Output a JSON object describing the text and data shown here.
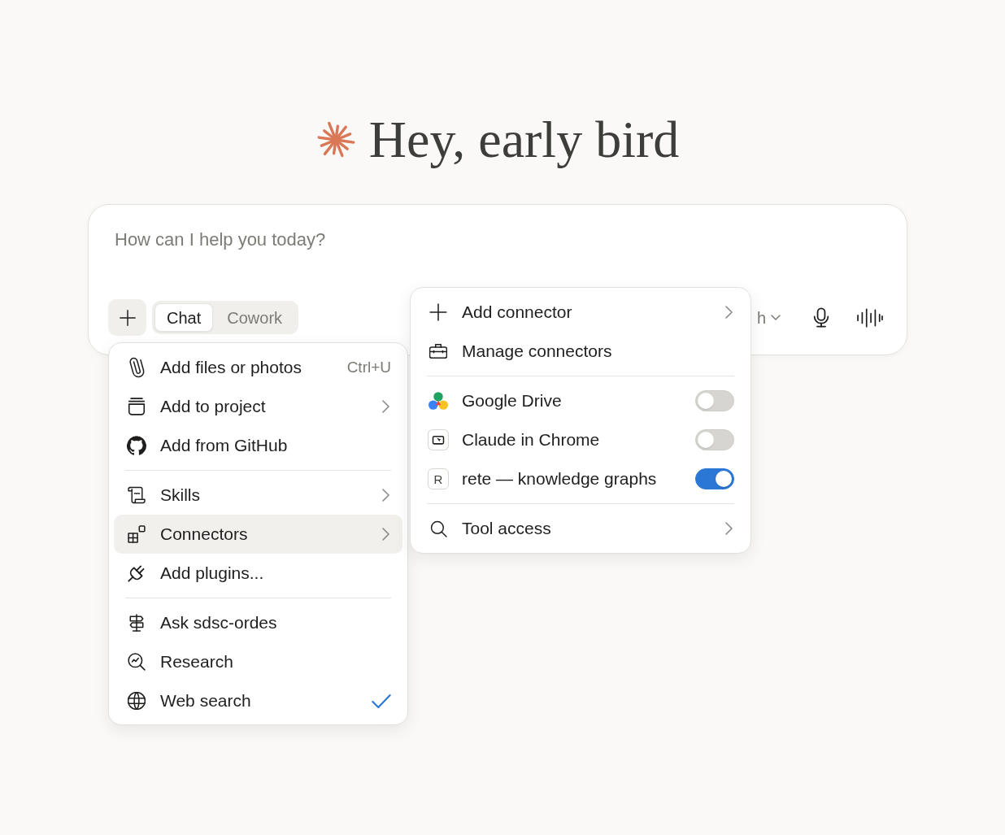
{
  "greeting": {
    "title": "Hey, early bird"
  },
  "composer": {
    "placeholder": "How can I help you today?",
    "mode_tabs": [
      {
        "label": "Chat",
        "selected": true
      },
      {
        "label": "Cowork",
        "selected": false
      }
    ],
    "model_selector": {
      "label": "h"
    }
  },
  "attach_menu": {
    "sections": [
      {
        "items": [
          {
            "label": "Add files or photos",
            "shortcut": "Ctrl+U",
            "submenu": false,
            "selected": false
          },
          {
            "label": "Add to project",
            "submenu": true,
            "selected": false
          },
          {
            "label": "Add from GitHub",
            "submenu": false,
            "selected": false
          }
        ]
      },
      {
        "items": [
          {
            "label": "Skills",
            "submenu": true,
            "selected": false
          },
          {
            "label": "Connectors",
            "submenu": true,
            "selected": true
          },
          {
            "label": "Add plugins...",
            "submenu": false,
            "selected": false
          }
        ]
      },
      {
        "items": [
          {
            "label": "Ask sdsc-ordes",
            "checked": false,
            "selected": false
          },
          {
            "label": "Research",
            "checked": false,
            "selected": false
          },
          {
            "label": "Web search",
            "checked": true,
            "selected": false
          }
        ]
      }
    ]
  },
  "connectors_menu": {
    "sections": [
      {
        "items": [
          {
            "label": "Add connector",
            "submenu": true
          },
          {
            "label": "Manage connectors",
            "submenu": false
          }
        ]
      },
      {
        "items": [
          {
            "label": "Google Drive",
            "on": false
          },
          {
            "label": "Claude in Chrome",
            "on": false
          },
          {
            "label": "rete — knowledge graphs",
            "letter": "R",
            "on": true
          }
        ]
      },
      {
        "items": [
          {
            "label": "Tool access",
            "submenu": true
          }
        ]
      }
    ]
  }
}
